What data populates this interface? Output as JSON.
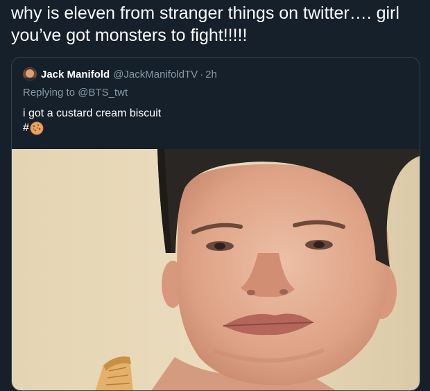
{
  "tweet": {
    "text_line1": "why is eleven from stranger things on twitter…. girl",
    "text_line2": "you’ve got monsters to fight!!!!!"
  },
  "quote": {
    "display_name": "Jack Manifold",
    "handle": "@JackManifoldTV",
    "separator": "·",
    "time": "2h",
    "replying_prefix": "Replying to",
    "replying_to": "@BTS_twt",
    "body": "i got a custard cream biscuit",
    "hashtag_symbol": "#",
    "hashtag_icon": "cookie-emoji-icon"
  },
  "colors": {
    "background": "#15202b",
    "border": "#38444d",
    "secondary_text": "#8899a6",
    "primary_text": "#ffffff"
  },
  "media": {
    "alt": "selfie photo"
  }
}
